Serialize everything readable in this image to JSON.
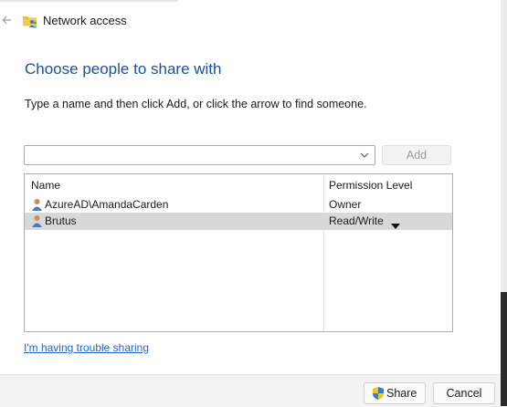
{
  "window": {
    "title": "Network access",
    "icon": "folder-users-icon",
    "back_icon": "back-arrow-icon"
  },
  "main": {
    "heading": "Choose people to share with",
    "instructions": "Type a name and then click Add, or click the arrow to find someone.",
    "name_input": {
      "value": "",
      "placeholder": ""
    },
    "add_label": "Add"
  },
  "list": {
    "columns": [
      "Name",
      "Permission Level"
    ],
    "rows": [
      {
        "name": "AzureAD\\AmandaCarden",
        "permission": "Owner",
        "icon": "user-icon",
        "selected": false
      },
      {
        "name": "Brutus",
        "permission": "Read/Write",
        "icon": "user-icon",
        "selected": true
      }
    ]
  },
  "help_link": "I'm having trouble sharing",
  "footer": {
    "share_label": "Share",
    "cancel_label": "Cancel",
    "share_icon": "uac-shield-icon"
  },
  "colors": {
    "heading": "#1e4e9c",
    "link": "#1f64c8",
    "selected_row": "#d8d8d8"
  }
}
